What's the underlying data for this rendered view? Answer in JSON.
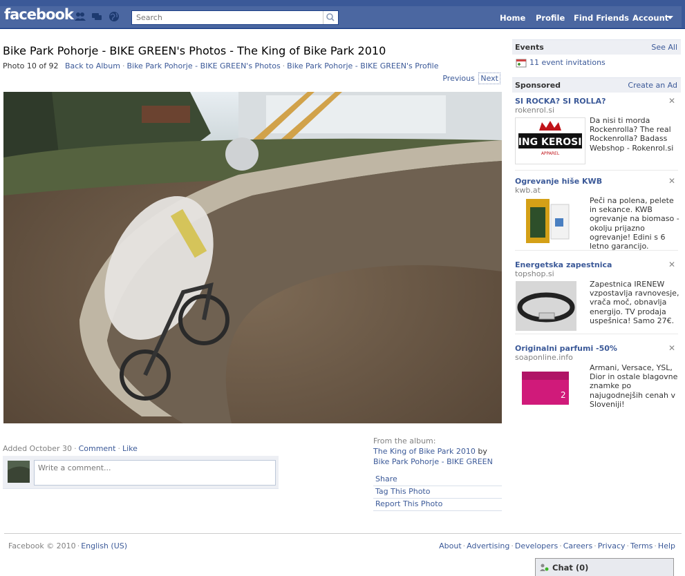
{
  "header": {
    "logo": "facebook",
    "search_placeholder": "Search",
    "nav": {
      "home": "Home",
      "profile": "Profile",
      "find_friends": "Find Friends",
      "account": "Account"
    }
  },
  "photo_page": {
    "title": "Bike Park Pohorje - BIKE GREEN's Photos - The King of Bike Park 2010",
    "photo_counter": "Photo 10 of 92",
    "breadcrumbs": [
      "Back to Album",
      "Bike Park Pohorje - BIKE GREEN's Photos",
      "Bike Park Pohorje - BIKE GREEN's Profile"
    ],
    "pager": {
      "previous": "Previous",
      "next": "Next"
    },
    "added": "Added October 30",
    "comment_link": "Comment",
    "like_link": "Like",
    "comment_placeholder": "Write a comment...",
    "album": {
      "from_label": "From the album:",
      "name": "The King of Bike Park 2010",
      "by": "by",
      "owner": "Bike Park Pohorje - BIKE GREEN"
    },
    "actions": [
      "Share",
      "Tag This Photo",
      "Report This Photo"
    ]
  },
  "sidebar": {
    "events": {
      "title": "Events",
      "see_all": "See All",
      "invitations": "11 event invitations"
    },
    "sponsored": {
      "title": "Sponsored",
      "create_ad": "Create an Ad"
    },
    "ads": [
      {
        "title": "SI ROCKA? SI ROLLA?",
        "domain": "rokenrol.si",
        "text": "Da nisi ti morda Rockenrolla? The real Rockenrolla? Badass Webshop - Rokenrol.si",
        "image_label": "KING KEROSIN",
        "image_sublabel": "APPAREL"
      },
      {
        "title": "Ogrevanje hiše KWB",
        "domain": "kwb.at",
        "text": "Peči na polena, pelete in sekance. KWB ogrevanje na biomaso - okolju prijazno ogrevanje! Edini s 6 letno garancijo."
      },
      {
        "title": "Energetska zapestnica",
        "domain": "topshop.si",
        "text": "Zapestnica IRENEW vzpostavlja ravnovesje, vrača moč, obnavlja energijo. TV prodaja uspešnica! Samo 27€."
      },
      {
        "title": "Originalni parfumi -50%",
        "domain": "soaponline.info",
        "text": "Armani, Versace, YSL, Dior in ostale blagovne znamke po najugodnejših cenah v Sloveniji!"
      }
    ]
  },
  "footer": {
    "copyright": "Facebook © 2010",
    "language": "English (US)",
    "links": [
      "About",
      "Advertising",
      "Developers",
      "Careers",
      "Privacy",
      "Terms",
      "Help"
    ]
  },
  "chat": {
    "label": "Chat (0)"
  },
  "colors": {
    "brand_blue": "#3b5998",
    "header_bar": "#4b67a1",
    "sidebar_header_bg": "#edeff4"
  }
}
